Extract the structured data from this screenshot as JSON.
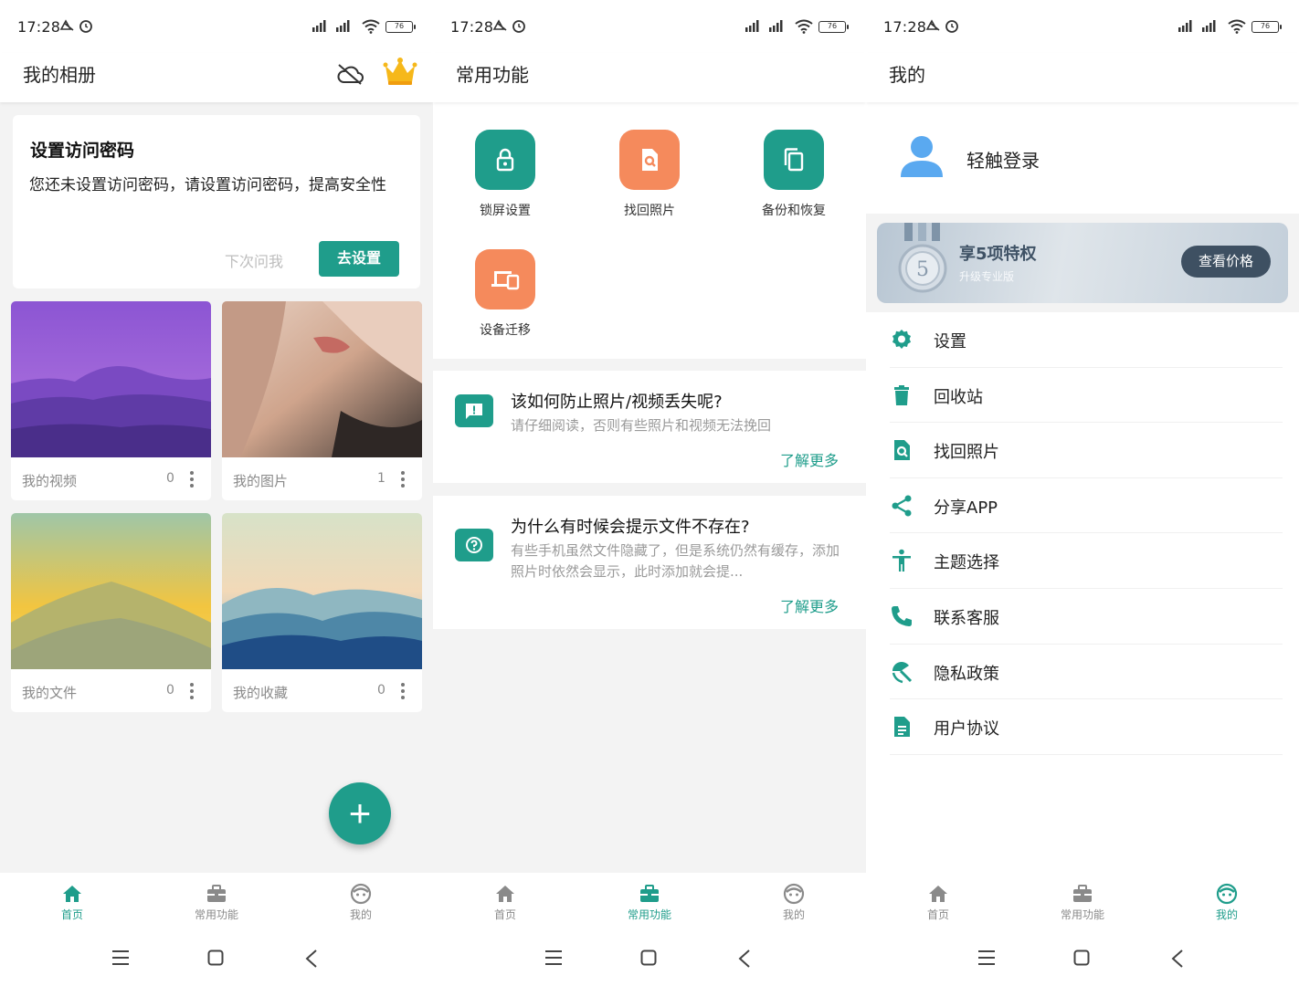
{
  "status": {
    "time": "17:28",
    "battery": "76"
  },
  "colors": {
    "accent": "#1f9d8b",
    "orange": "#f58a5c",
    "vip_button": "#3e5062"
  },
  "screen_home": {
    "title": "我的相册",
    "icons": [
      "cloud-off-icon",
      "crown-icon"
    ],
    "password_card": {
      "title": "设置访问密码",
      "desc": "您还未设置访问密码，请设置访问密码，提高安全性",
      "later": "下次问我",
      "go": "去设置"
    },
    "albums": [
      {
        "name": "我的视频",
        "count": "0"
      },
      {
        "name": "我的图片",
        "count": "1"
      },
      {
        "name": "我的文件",
        "count": "0"
      },
      {
        "name": "我的收藏",
        "count": "0"
      }
    ],
    "fab": "+"
  },
  "screen_functions": {
    "title": "常用功能",
    "functions": [
      {
        "label": "锁屏设置",
        "icon": "lock-icon",
        "color": "#1f9d8b"
      },
      {
        "label": "找回照片",
        "icon": "file-search-icon",
        "color": "#f58a5c"
      },
      {
        "label": "备份和恢复",
        "icon": "copy-icon",
        "color": "#1f9d8b"
      },
      {
        "label": "设备迁移",
        "icon": "devices-icon",
        "color": "#f58a5c"
      }
    ],
    "faq": [
      {
        "q": "该如何防止照片/视频丢失呢?",
        "a": "请仔细阅读，否则有些照片和视频无法挽回",
        "more": "了解更多"
      },
      {
        "q": "为什么有时候会提示文件不存在?",
        "a": "有些手机虽然文件隐藏了，但是系统仍然有缓存，添加照片时依然会显示，此时添加就会提...",
        "more": "了解更多"
      }
    ]
  },
  "screen_mine": {
    "title": "我的",
    "login": "轻触登录",
    "vip": {
      "title": "享5项特权",
      "subtitle": "升级专业版",
      "button": "查看价格",
      "medal": "5"
    },
    "menu": [
      {
        "label": "设置",
        "icon": "gear-icon"
      },
      {
        "label": "回收站",
        "icon": "trash-icon"
      },
      {
        "label": "找回照片",
        "icon": "file-search-icon"
      },
      {
        "label": "分享APP",
        "icon": "share-icon"
      },
      {
        "label": "主题选择",
        "icon": "accessibility-icon"
      },
      {
        "label": "联系客服",
        "icon": "phone-icon"
      },
      {
        "label": "隐私政策",
        "icon": "privacy-icon"
      },
      {
        "label": "用户协议",
        "icon": "document-icon"
      }
    ]
  },
  "bottom_nav": {
    "home": "首页",
    "functions": "常用功能",
    "mine": "我的"
  }
}
